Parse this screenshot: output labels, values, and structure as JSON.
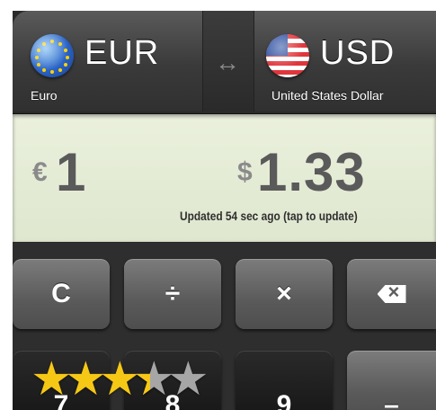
{
  "from_currency": {
    "code": "EUR",
    "name": "Euro",
    "icon": "eu-flag-globe-icon"
  },
  "to_currency": {
    "code": "USD",
    "name": "United States Dollar",
    "icon": "us-flag-globe-icon"
  },
  "swap": {
    "icon": "swap-arrows-icon",
    "glyph": "↔"
  },
  "display": {
    "from_symbol": "€",
    "from_amount": "1",
    "to_symbol": "$",
    "to_amount": "1.33",
    "status": "Updated 54 sec ago (tap to update)"
  },
  "keys": {
    "clear": "C",
    "divide": "÷",
    "multiply": "×",
    "backspace_icon": "backspace-icon",
    "seven": "7",
    "eight": "8",
    "nine": "9",
    "minus": "–"
  },
  "rating": {
    "value": 3.5,
    "max": 5
  },
  "colors": {
    "display_bg": "#e5ecd6",
    "star_filled": "#f6c816",
    "star_empty": "#a6a6a6"
  }
}
